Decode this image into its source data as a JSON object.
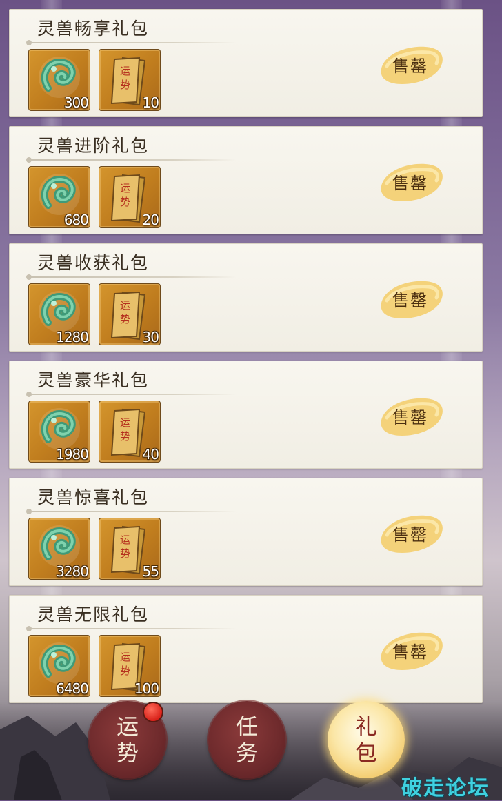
{
  "packs": [
    {
      "title": "灵兽畅享礼包",
      "jade_count": "300",
      "scroll_count": "10",
      "status": "售罄"
    },
    {
      "title": "灵兽进阶礼包",
      "jade_count": "680",
      "scroll_count": "20",
      "status": "售罄"
    },
    {
      "title": "灵兽收获礼包",
      "jade_count": "1280",
      "scroll_count": "30",
      "status": "售罄"
    },
    {
      "title": "灵兽豪华礼包",
      "jade_count": "1980",
      "scroll_count": "40",
      "status": "售罄"
    },
    {
      "title": "灵兽惊喜礼包",
      "jade_count": "3280",
      "scroll_count": "55",
      "status": "售罄"
    },
    {
      "title": "灵兽无限礼包",
      "jade_count": "6480",
      "scroll_count": "100",
      "status": "售罄"
    }
  ],
  "item_icons": {
    "jade": "jade-pendant-icon",
    "scroll": "fortune-scroll-icon"
  },
  "nav": {
    "fortune": {
      "line1": "运",
      "line2": "势"
    },
    "tasks": {
      "line1": "任",
      "line2": "务"
    },
    "gift": {
      "line1": "礼",
      "line2": "包"
    }
  },
  "watermark": "破走论坛",
  "colors": {
    "accent_gold": "#f2c866",
    "nav_red": "#6e2a2c",
    "badge_red": "#d9221a",
    "watermark": "#3fd1e0"
  }
}
